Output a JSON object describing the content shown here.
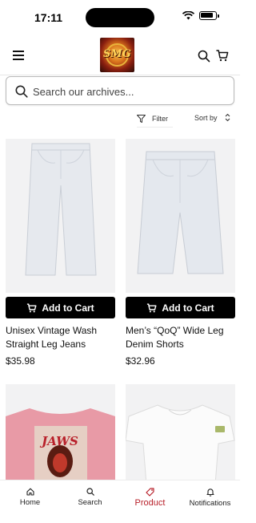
{
  "status_bar": {
    "time": "17:11"
  },
  "header": {
    "logo_text": "SMG"
  },
  "search": {
    "placeholder": "Search our archives..."
  },
  "toolbar": {
    "filter_label": "Filter",
    "sort_label": "Sort by"
  },
  "products": [
    {
      "name": "Unisex Vintage Wash Straight Leg Jeans",
      "price": "$35.98",
      "button_label": "Add to Cart"
    },
    {
      "name": "Men’s “QoQ” Wide Leg Denim Shorts",
      "price": "$32.96",
      "button_label": "Add to Cart"
    },
    {
      "graphic_text": "JAWS"
    },
    {}
  ],
  "nav": {
    "items": [
      {
        "label": "Home",
        "icon": "home-icon"
      },
      {
        "label": "Search",
        "icon": "search-icon"
      },
      {
        "label": "Product",
        "icon": "tag-icon",
        "active": true
      },
      {
        "label": "Notifications",
        "icon": "bell-icon"
      }
    ]
  },
  "colors": {
    "accent": "#b8202a",
    "button_bg": "#000000",
    "card_bg": "#f2f2f3"
  }
}
